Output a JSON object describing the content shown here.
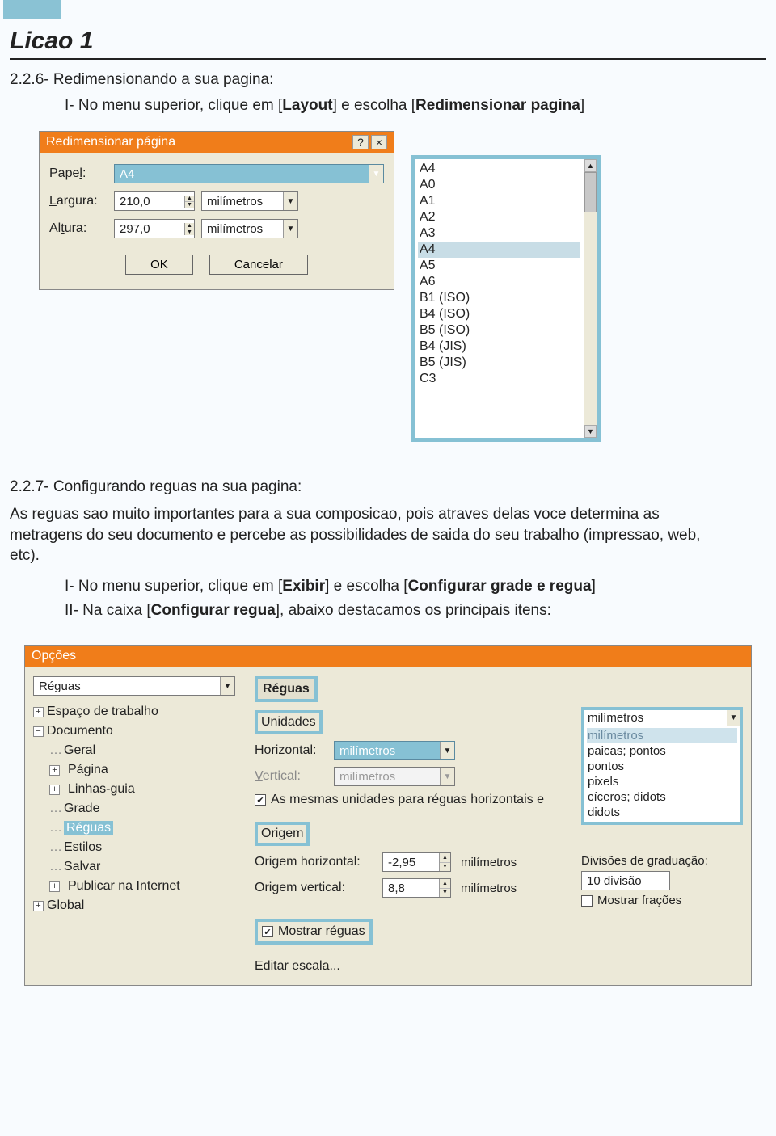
{
  "lesson_title": "Licao 1",
  "section_226": {
    "heading": "2.2.6- Redimensionando a sua pagina:",
    "instruction_prefix": "I-  No menu superior, clique em [",
    "instruction_b1": "Layout",
    "instruction_mid": "] e escolha [",
    "instruction_b2": "Redimensionar pagina",
    "instruction_suffix": "]"
  },
  "dialog1": {
    "title": "Redimensionar página",
    "help_glyph": "?",
    "close_glyph": "×",
    "papel_label": "Papel:",
    "papel_value": "A4",
    "largura_label": "Largura:",
    "largura_value": "210,0",
    "altura_label": "Altura:",
    "altura_value": "297,0",
    "unit": "milímetros",
    "ok": "OK",
    "cancel": "Cancelar",
    "paper_options": [
      "A4",
      "A0",
      "A1",
      "A2",
      "A3",
      "A4",
      "A5",
      "A6",
      "B1 (ISO)",
      "B4 (ISO)",
      "B5 (ISO)",
      "B4 (JIS)",
      "B5 (JIS)",
      "C3"
    ],
    "paper_selected_index": 5
  },
  "section_227": {
    "heading": "2.2.7- Configurando reguas na sua pagina:",
    "para": "As reguas sao muito importantes para a sua composicao, pois atraves delas voce determina as metragens do seu documento e percebe as possibilidades de saida do seu trabalho (impressao, web, etc).",
    "item1_prefix": "I- No menu superior, clique em [",
    "item1_b1": "Exibir",
    "item1_mid": "] e escolha [",
    "item1_b2": "Configurar grade e regua",
    "item1_suffix": "]",
    "item2_prefix": "II- Na caixa [",
    "item2_b1": "Configurar regua",
    "item2_suffix": "], abaixo destacamos os principais itens:"
  },
  "options": {
    "title": "Opções",
    "tree_selector": "Réguas",
    "tree": {
      "workspace": "Espaço de trabalho",
      "document": "Documento",
      "geral": "Geral",
      "pagina": "Página",
      "linhasguia": "Linhas-guia",
      "grade": "Grade",
      "reguas": "Réguas",
      "estilos": "Estilos",
      "salvar": "Salvar",
      "publicar": "Publicar na Internet",
      "global": "Global"
    },
    "panel_title": "Réguas",
    "unidades_label": "Unidades",
    "horizontal_label": "Horizontal:",
    "horizontal_value": "milímetros",
    "vertical_label": "Vertical:",
    "vertical_value": "milímetros",
    "same_units_label": "As mesmas unidades para réguas horizontais e",
    "origem_label": "Origem",
    "origem_h_label": "Origem horizontal:",
    "origem_h_value": "-2,95",
    "origem_v_label": "Origem vertical:",
    "origem_v_value": "8,8",
    "unit": "milímetros",
    "mostrar_reguas": "Mostrar réguas",
    "editar_escala": "Editar escala...",
    "unit_options": [
      "milímetros",
      "milímetros",
      "paicas; pontos",
      "pontos",
      "pixels",
      "cíceros; didots",
      "didots"
    ],
    "unit_selected_index": 1,
    "divisoes_label": "Divisões de graduação:",
    "divisoes_value": "10 divisão",
    "mostrar_fracoes": "Mostrar frações"
  }
}
